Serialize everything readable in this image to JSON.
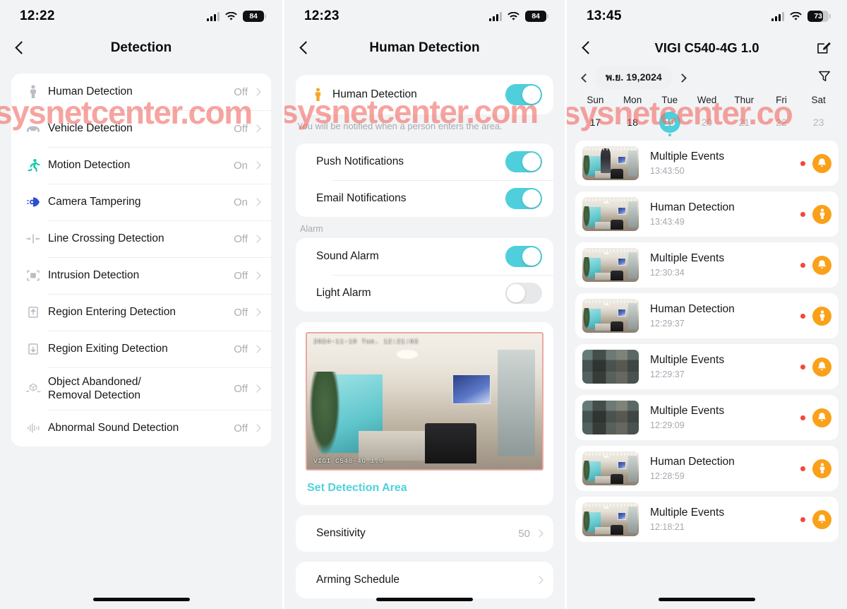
{
  "screens": {
    "detection": {
      "status": {
        "time": "12:22",
        "battery": "84",
        "battery_level": 84
      },
      "nav": {
        "back_icon": "chevron-left-icon",
        "title": "Detection"
      },
      "items": [
        {
          "icon": "person-icon",
          "label": "Human Detection",
          "value": "Off"
        },
        {
          "icon": "car-icon",
          "label": "Vehicle Detection",
          "value": "Off"
        },
        {
          "icon": "running-person-icon",
          "label": "Motion Detection",
          "value": "On"
        },
        {
          "icon": "camera-tamper-icon",
          "label": "Camera Tampering",
          "value": "On"
        },
        {
          "icon": "line-crossing-icon",
          "label": "Line Crossing Detection",
          "value": "Off"
        },
        {
          "icon": "intrusion-icon",
          "label": "Intrusion Detection",
          "value": "Off"
        },
        {
          "icon": "region-entering-icon",
          "label": "Region Entering Detection",
          "value": "Off"
        },
        {
          "icon": "region-exiting-icon",
          "label": "Region Exiting Detection",
          "value": "Off"
        },
        {
          "icon": "object-abandoned-icon",
          "label": "Object Abandoned/\nRemoval Detection",
          "value": "Off"
        },
        {
          "icon": "sound-wave-icon",
          "label": "Abnormal Sound Detection",
          "value": "Off"
        }
      ],
      "watermark": "sysnetcenter.com"
    },
    "human_detection": {
      "status": {
        "time": "12:23",
        "battery": "84",
        "battery_level": 84
      },
      "nav": {
        "back_icon": "chevron-left-icon",
        "title": "Human Detection"
      },
      "main_toggle": {
        "icon": "person-orange-icon",
        "label": "Human Detection",
        "state": "on"
      },
      "hint": "You will be notified when a person enters the area.",
      "notifications": [
        {
          "label": "Push Notifications",
          "state": "on"
        },
        {
          "label": "Email Notifications",
          "state": "on"
        }
      ],
      "alarm_header": "Alarm",
      "alarms": [
        {
          "label": "Sound Alarm",
          "state": "on"
        },
        {
          "label": "Light Alarm",
          "state": "off"
        }
      ],
      "preview": {
        "osd_timestamp": "2024-11-19 Tue. 12:21:03",
        "osd_device": "VIGI C540-4G 1.0"
      },
      "set_detection_area": "Set Detection Area",
      "sensitivity": {
        "label": "Sensitivity",
        "value": "50"
      },
      "arming_schedule": {
        "label": "Arming Schedule"
      },
      "watermark": "sysnetcenter.com"
    },
    "events": {
      "status": {
        "time": "13:45",
        "battery": "73",
        "battery_level": 73
      },
      "nav": {
        "back_icon": "chevron-left-icon",
        "title": "VIGI C540-4G 1.0",
        "edit_icon": "edit-square-icon"
      },
      "datebar": {
        "prev_icon": "chevron-left-icon",
        "date_label": "พ.ย. 19,2024",
        "next_icon": "chevron-right-icon",
        "filter_icon": "funnel-filter-icon"
      },
      "week": [
        {
          "name": "Sun",
          "num": "17",
          "selected": false,
          "dim": false
        },
        {
          "name": "Mon",
          "num": "18",
          "selected": false,
          "dim": false
        },
        {
          "name": "Tue",
          "num": "19",
          "selected": true,
          "dim": false
        },
        {
          "name": "Wed",
          "num": "20",
          "selected": false,
          "dim": true
        },
        {
          "name": "Thur",
          "num": "21",
          "selected": false,
          "dim": true
        },
        {
          "name": "Fri",
          "num": "22",
          "selected": false,
          "dim": true
        },
        {
          "name": "Sat",
          "num": "23",
          "selected": false,
          "dim": true
        }
      ],
      "events": [
        {
          "title": "Multiple Events",
          "time": "13:43:50",
          "icon": "bell-icon",
          "unread": true,
          "thumb": "person-standing",
          "blurred": false
        },
        {
          "title": "Human Detection",
          "time": "13:43:49",
          "icon": "person-icon",
          "unread": true,
          "thumb": "room",
          "blurred": false
        },
        {
          "title": "Multiple Events",
          "time": "12:30:34",
          "icon": "bell-icon",
          "unread": true,
          "thumb": "room",
          "blurred": false
        },
        {
          "title": "Human Detection",
          "time": "12:29:37",
          "icon": "person-icon",
          "unread": true,
          "thumb": "room",
          "blurred": false
        },
        {
          "title": "Multiple Events",
          "time": "12:29:37",
          "icon": "bell-icon",
          "unread": true,
          "thumb": "room",
          "blurred": true
        },
        {
          "title": "Multiple Events",
          "time": "12:29:09",
          "icon": "bell-icon",
          "unread": true,
          "thumb": "room",
          "blurred": true
        },
        {
          "title": "Human Detection",
          "time": "12:28:59",
          "icon": "person-icon",
          "unread": true,
          "thumb": "room",
          "blurred": false
        },
        {
          "title": "Multiple Events",
          "time": "12:18:21",
          "icon": "bell-icon",
          "unread": true,
          "thumb": "room",
          "blurred": false
        }
      ],
      "watermark": "sysnetcenter.co"
    }
  },
  "colors": {
    "accent_teal": "#4ecfdb",
    "event_orange": "#faa119",
    "unread_red": "#f5463c",
    "watermark_red": "#f26d67",
    "page_bg": "#f2f3f5",
    "card_bg": "#ffffff"
  }
}
